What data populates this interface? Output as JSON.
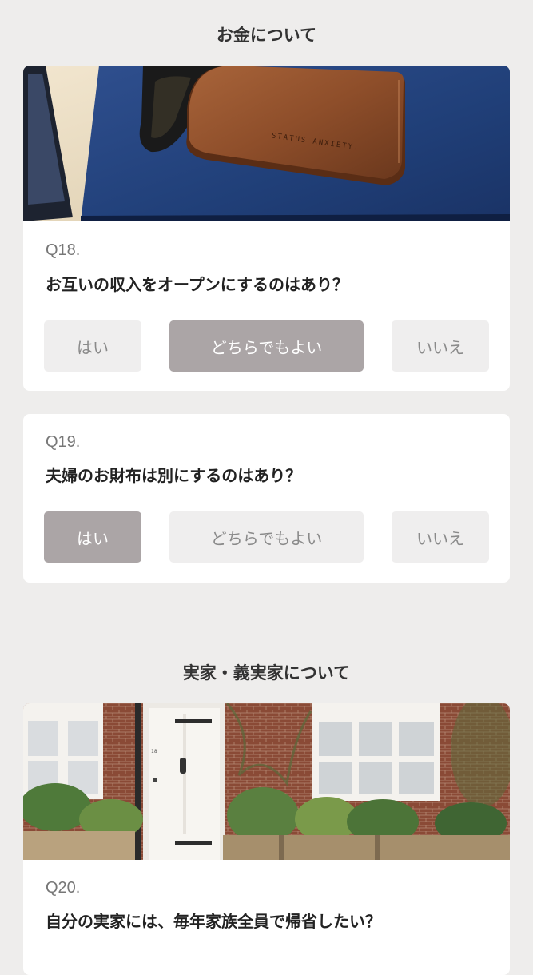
{
  "sections": [
    {
      "title": "お金について",
      "questions": [
        {
          "number": "Q18.",
          "text": "お互いの収入をオープンにするのはあり？",
          "options": [
            "はい",
            "どちらでもよい",
            "いいえ"
          ],
          "selected": "どちらでもよい",
          "photo_caption": "STATUS ANXIETY."
        },
        {
          "number": "Q19.",
          "text": "夫婦のお財布は別にするのはあり？",
          "options": [
            "はい",
            "どちらでもよい",
            "いいえ"
          ],
          "selected": "はい"
        }
      ]
    },
    {
      "title": "実家・義実家について",
      "questions": [
        {
          "number": "Q20.",
          "text": "自分の実家には、毎年家族全員で帰省したい？",
          "door_number": "18"
        }
      ]
    }
  ],
  "colors": {
    "background": "#eeedec",
    "card": "#ffffff",
    "option": "#efeeee",
    "option_selected": "#aba5a6"
  }
}
